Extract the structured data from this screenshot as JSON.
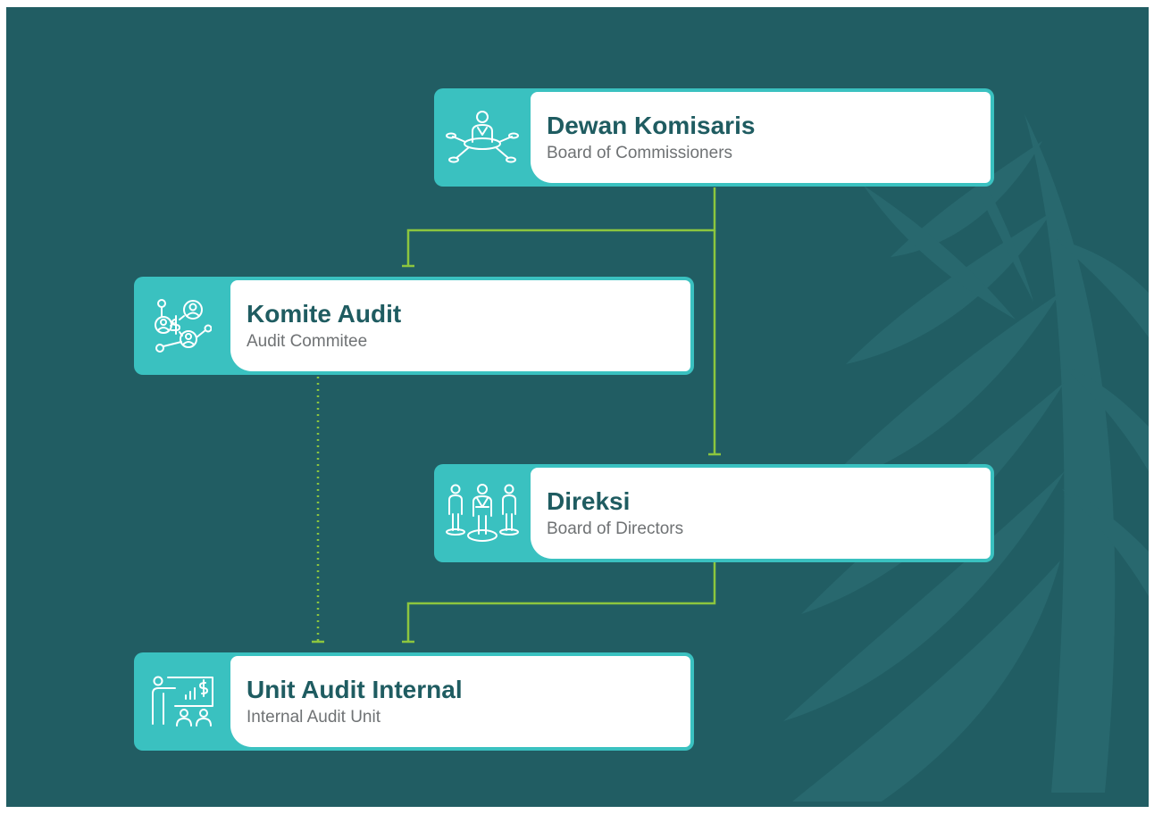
{
  "diagram": {
    "nodes": [
      {
        "id": "dewan-komisaris",
        "title": "Dewan Komisaris",
        "subtitle": "Board of Commissioners",
        "icon": "board-meeting-icon"
      },
      {
        "id": "komite-audit",
        "title": "Komite Audit",
        "subtitle": "Audit Commitee",
        "icon": "network-money-icon"
      },
      {
        "id": "direksi",
        "title": "Direksi",
        "subtitle": "Board of Directors",
        "icon": "directors-group-icon"
      },
      {
        "id": "unit-audit-internal",
        "title": "Unit Audit Internal",
        "subtitle": "Internal Audit Unit",
        "icon": "presentation-icon"
      }
    ],
    "edges": [
      {
        "from": "dewan-komisaris",
        "to": "komite-audit",
        "style": "solid"
      },
      {
        "from": "dewan-komisaris",
        "to": "direksi",
        "style": "solid"
      },
      {
        "from": "direksi",
        "to": "unit-audit-internal",
        "style": "solid"
      },
      {
        "from": "komite-audit",
        "to": "unit-audit-internal",
        "style": "dotted"
      }
    ]
  },
  "colors": {
    "background": "#215d63",
    "accent": "#3ac1c0",
    "connector": "#8cc63e",
    "title": "#1f5c61",
    "subtitle": "#6f7274"
  }
}
